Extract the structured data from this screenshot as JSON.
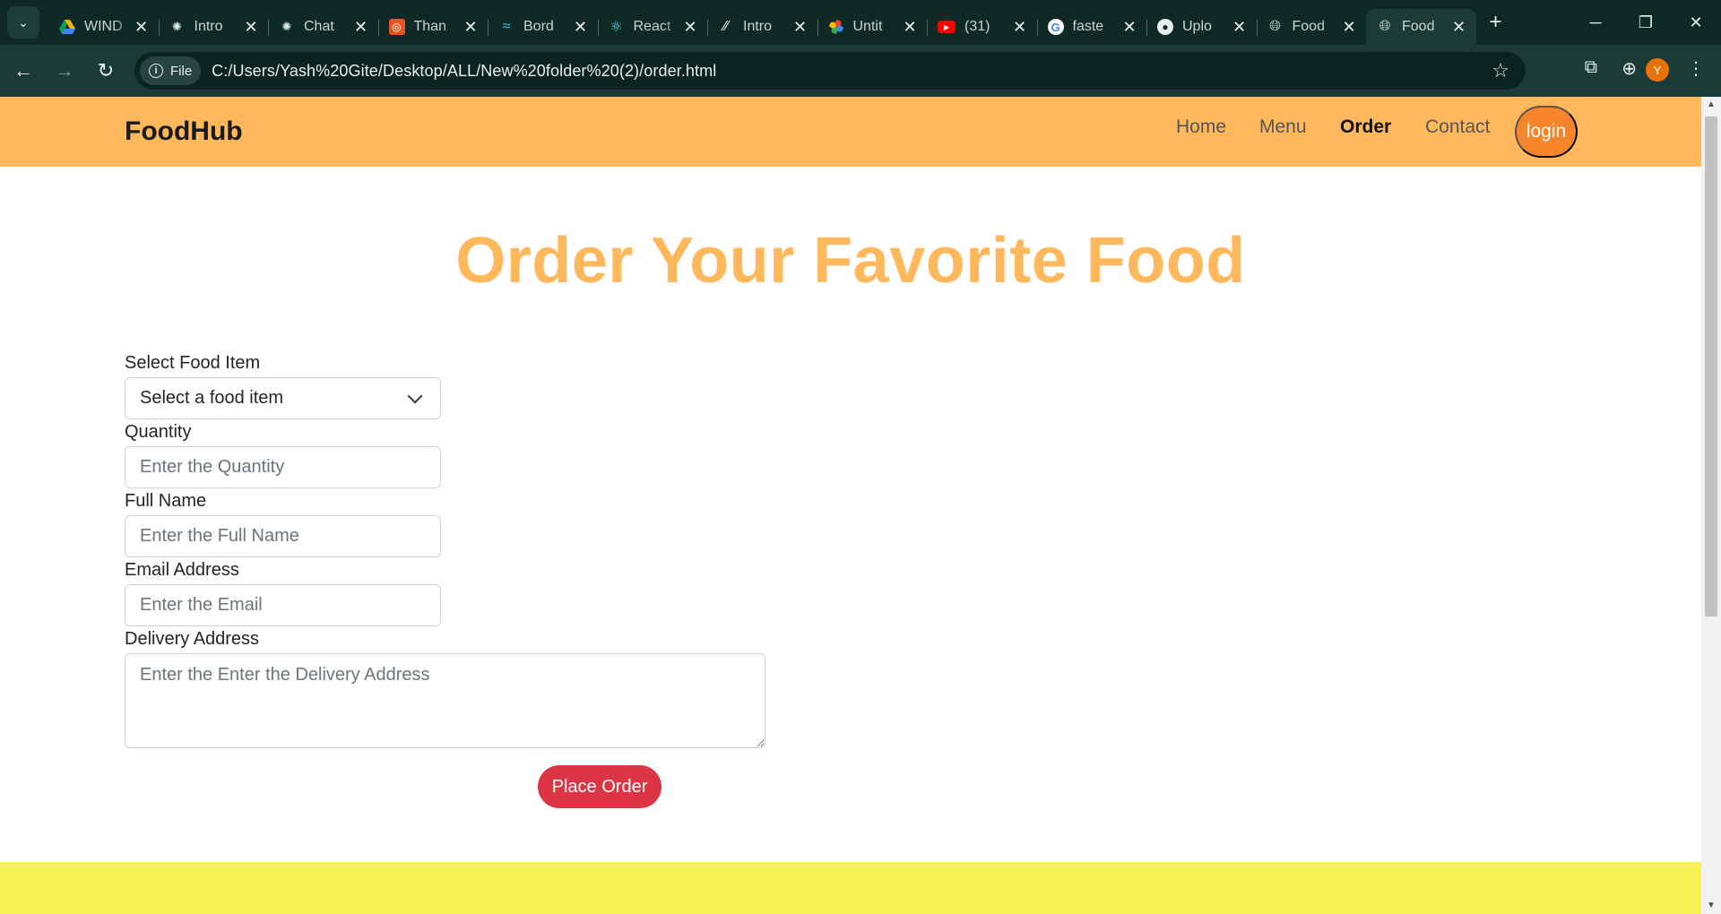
{
  "browser": {
    "tabs": [
      {
        "title": "WIND",
        "favicon": "drive-icon",
        "active": false
      },
      {
        "title": "Intro",
        "favicon": "openai-icon",
        "active": false
      },
      {
        "title": "Chat",
        "favicon": "openai-icon",
        "active": false
      },
      {
        "title": "Than",
        "favicon": "ubuntu-icon",
        "active": false
      },
      {
        "title": "Bord",
        "favicon": "tailwind-icon",
        "active": false
      },
      {
        "title": "React",
        "favicon": "react-icon",
        "active": false
      },
      {
        "title": "Intro",
        "favicon": "slash-icon",
        "active": false
      },
      {
        "title": "Untit",
        "favicon": "pinwheel-icon",
        "active": false
      },
      {
        "title": "(31)",
        "favicon": "youtube-icon",
        "active": false
      },
      {
        "title": "faste",
        "favicon": "google-icon",
        "active": false
      },
      {
        "title": "Uplo",
        "favicon": "github-icon",
        "active": false
      },
      {
        "title": "Food",
        "favicon": "globe-icon",
        "active": false
      },
      {
        "title": "Food",
        "favicon": "globe-icon",
        "active": true
      }
    ],
    "site_chip_label": "File",
    "url": "C:/Users/Yash%20Gite/Desktop/ALL/New%20folder%20(2)/order.html",
    "profile_initial": "Y"
  },
  "site": {
    "brand": "FoodHub",
    "nav": [
      {
        "label": "Home",
        "active": false
      },
      {
        "label": "Menu",
        "active": false
      },
      {
        "label": "Order",
        "active": true
      },
      {
        "label": "Contact",
        "active": false
      }
    ],
    "login_label": "login"
  },
  "order_form": {
    "title": "Order Your Favorite Food",
    "food_item": {
      "label": "Select Food Item",
      "selected": "Select a food item"
    },
    "quantity": {
      "label": "Quantity",
      "placeholder": "Enter the Quantity"
    },
    "full_name": {
      "label": "Full Name",
      "placeholder": "Enter the Full Name"
    },
    "email": {
      "label": "Email Address",
      "placeholder": "Enter the Email"
    },
    "delivery_address": {
      "label": "Delivery Address",
      "placeholder": "Enter the Enter the Delivery Address"
    },
    "submit_label": "Place Order"
  },
  "colors": {
    "header_bg": "#ffb85c",
    "title": "#ffb85c",
    "login_bg": "#f5842a",
    "submit_bg": "#dc3545",
    "footer_bg": "#f5f252",
    "browser_frame": "#0f2a26"
  }
}
